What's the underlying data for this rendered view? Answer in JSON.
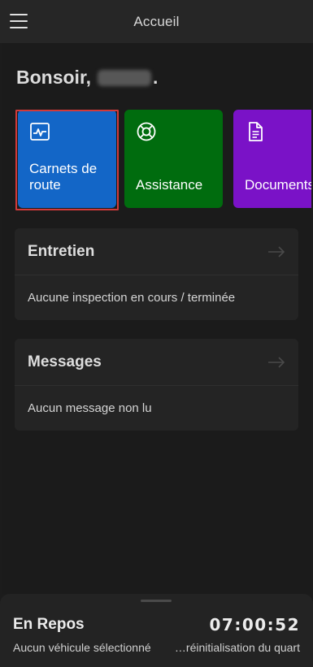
{
  "header": {
    "title": "Accueil",
    "menu_icon": "hamburger-menu-icon"
  },
  "greeting": {
    "text": "Bonsoir,",
    "suffix": "."
  },
  "tiles": [
    {
      "label": "Carnets de route",
      "icon": "logbook-chart-icon",
      "color": "#1366c7"
    },
    {
      "label": "Assistance",
      "icon": "lifebuoy-icon",
      "color": "#006c0e"
    },
    {
      "label": "Documents",
      "icon": "document-icon",
      "color": "#7a12c7"
    }
  ],
  "cards": {
    "maintenance": {
      "title": "Entretien",
      "text": "Aucune inspection en cours / terminée"
    },
    "messages": {
      "title": "Messages",
      "text": "Aucun message non lu"
    }
  },
  "footer": {
    "status": "En Repos",
    "timer": "07:00:52",
    "vehicle": "Aucun véhicule sélectionné",
    "reset": "…réinitialisation du quart"
  }
}
